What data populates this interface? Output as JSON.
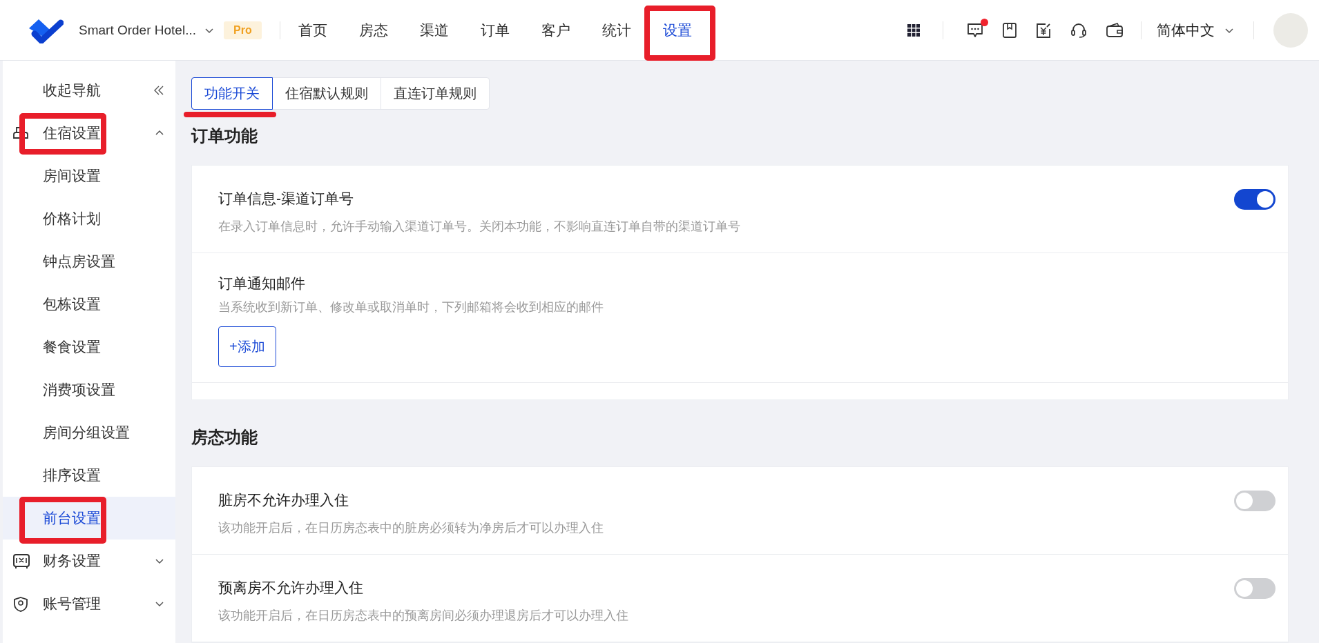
{
  "header": {
    "app_name": "Smart Order Hotel...",
    "plan_badge": "Pro",
    "nav": [
      {
        "label": "首页",
        "selected": false,
        "annotated": false
      },
      {
        "label": "房态",
        "selected": false,
        "annotated": false
      },
      {
        "label": "渠道",
        "selected": false,
        "annotated": false
      },
      {
        "label": "订单",
        "selected": false,
        "annotated": false
      },
      {
        "label": "客户",
        "selected": false,
        "annotated": false
      },
      {
        "label": "统计",
        "selected": false,
        "annotated": false
      },
      {
        "label": "设置",
        "selected": true,
        "annotated": true
      }
    ],
    "messages_unread": true,
    "language": "简体中文"
  },
  "sidebar": {
    "collapse_label": "收起导航",
    "groups": [
      {
        "label": "住宿设置",
        "expanded": true,
        "annotated": true,
        "children": [
          {
            "label": "房间设置",
            "selected": false,
            "annotated": false
          },
          {
            "label": "价格计划",
            "selected": false,
            "annotated": false
          },
          {
            "label": "钟点房设置",
            "selected": false,
            "annotated": false
          },
          {
            "label": "包栋设置",
            "selected": false,
            "annotated": false
          },
          {
            "label": "餐食设置",
            "selected": false,
            "annotated": false
          },
          {
            "label": "消费项设置",
            "selected": false,
            "annotated": false
          },
          {
            "label": "房间分组设置",
            "selected": false,
            "annotated": false
          },
          {
            "label": "排序设置",
            "selected": false,
            "annotated": false
          },
          {
            "label": "前台设置",
            "selected": true,
            "annotated": true
          }
        ]
      },
      {
        "label": "财务设置",
        "expanded": false,
        "annotated": false
      },
      {
        "label": "账号管理",
        "expanded": false,
        "annotated": false
      }
    ]
  },
  "tabs": [
    {
      "label": "功能开关",
      "selected": true,
      "annotated": true
    },
    {
      "label": "住宿默认规则",
      "selected": false,
      "annotated": false
    },
    {
      "label": "直连订单规则",
      "selected": false,
      "annotated": false
    }
  ],
  "sections": [
    {
      "title": "订单功能",
      "rows": [
        {
          "kind": "toggle",
          "title": "订单信息-渠道订单号",
          "description": "在录入订单信息时，允许手动输入渠道订单号。关闭本功能，不影响直连订单自带的渠道订单号",
          "on": true
        },
        {
          "kind": "emails",
          "title": "订单通知邮件",
          "description": "当系统收到新订单、修改单或取消单时，下列邮箱将会收到相应的邮件",
          "button": "+添加"
        }
      ]
    },
    {
      "title": "房态功能",
      "rows": [
        {
          "kind": "toggle",
          "title": "脏房不允许办理入住",
          "description": "该功能开启后，在日历房态表中的脏房必须转为净房后才可以办理入住",
          "on": false
        },
        {
          "kind": "toggle",
          "title": "预离房不允许办理入住",
          "description": "该功能开启后，在日历房态表中的预离房间必须办理退房后才可以办理入住",
          "on": false
        }
      ]
    }
  ]
}
